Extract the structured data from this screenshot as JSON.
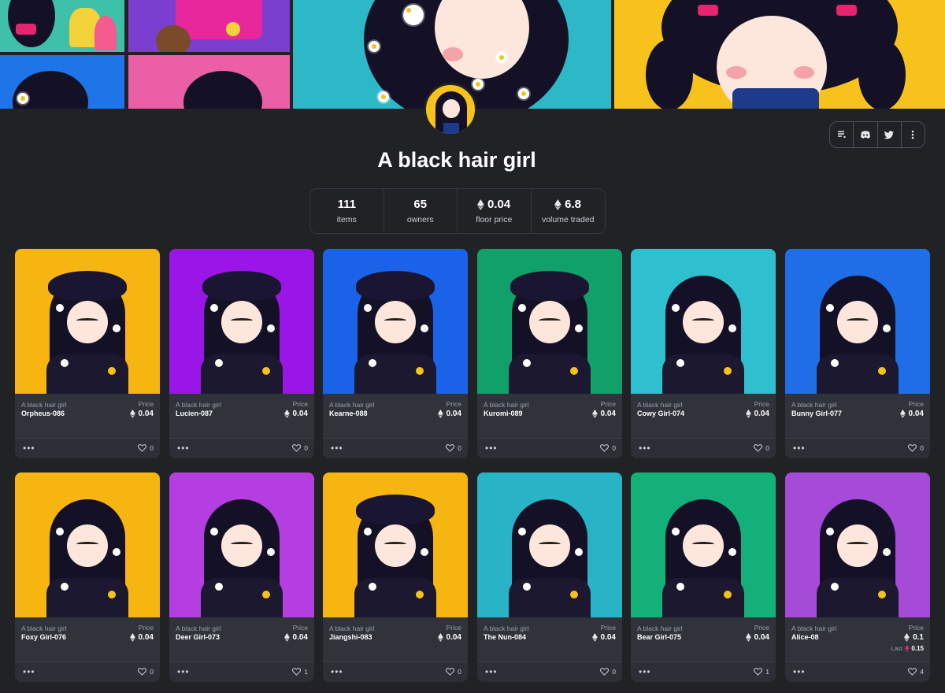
{
  "collection": {
    "title": "A black hair girl",
    "stats": [
      {
        "value": "111",
        "label": "items",
        "eth": false
      },
      {
        "value": "65",
        "label": "owners",
        "eth": false
      },
      {
        "value": "0.04",
        "label": "floor price",
        "eth": true
      },
      {
        "value": "6.8",
        "label": "volume traded",
        "eth": true
      }
    ],
    "social_icons": [
      "activity-icon",
      "discord-icon",
      "twitter-icon",
      "more-vertical-icon"
    ]
  },
  "colors": {
    "background": "#202225",
    "card": "#303339",
    "accent_eth": "#e5e8eb",
    "last_sale_eth": "#e6246f"
  },
  "items": [
    {
      "collection": "A black hair girl",
      "name": "Orpheus-086",
      "price_label": "Price",
      "price": "0.04",
      "likes": "0",
      "bg": "#f7b511",
      "hat": true
    },
    {
      "collection": "A black hair girl",
      "name": "Lucien-087",
      "price_label": "Price",
      "price": "0.04",
      "likes": "0",
      "bg": "#9a16e6",
      "hat": true
    },
    {
      "collection": "A black hair girl",
      "name": "Kearne-088",
      "price_label": "Price",
      "price": "0.04",
      "likes": "0",
      "bg": "#1a63e8",
      "hat": true
    },
    {
      "collection": "A black hair girl",
      "name": "Kuromi-089",
      "price_label": "Price",
      "price": "0.04",
      "likes": "0",
      "bg": "#12a06a",
      "hat": true
    },
    {
      "collection": "A black hair girl",
      "name": "Cowy Girl-074",
      "price_label": "Price",
      "price": "0.04",
      "likes": "0",
      "bg": "#2ec0cf",
      "hat": false
    },
    {
      "collection": "A black hair girl",
      "name": "Bunny Girl-077",
      "price_label": "Price",
      "price": "0.04",
      "likes": "0",
      "bg": "#1f6ee8",
      "hat": false
    },
    {
      "collection": "A black hair girl",
      "name": "Foxy Girl-076",
      "price_label": "Price",
      "price": "0.04",
      "likes": "0",
      "bg": "#f7b511",
      "hat": false
    },
    {
      "collection": "A black hair girl",
      "name": "Deer Girl-073",
      "price_label": "Price",
      "price": "0.04",
      "likes": "1",
      "bg": "#b53ee0",
      "hat": false
    },
    {
      "collection": "A black hair girl",
      "name": "Jiangshi-083",
      "price_label": "Price",
      "price": "0.04",
      "likes": "0",
      "bg": "#f7b511",
      "hat": true
    },
    {
      "collection": "A black hair girl",
      "name": "The Nun-084",
      "price_label": "Price",
      "price": "0.04",
      "likes": "0",
      "bg": "#28b3c6",
      "hat": false
    },
    {
      "collection": "A black hair girl",
      "name": "Bear Girl-075",
      "price_label": "Price",
      "price": "0.04",
      "likes": "1",
      "bg": "#13b07a",
      "hat": false
    },
    {
      "collection": "A black hair girl",
      "name": "Alice-08",
      "price_label": "Price",
      "price": "0.1",
      "likes": "4",
      "bg": "#a64ad8",
      "hat": false,
      "last_label": "Last",
      "last_price": "0.15"
    }
  ]
}
